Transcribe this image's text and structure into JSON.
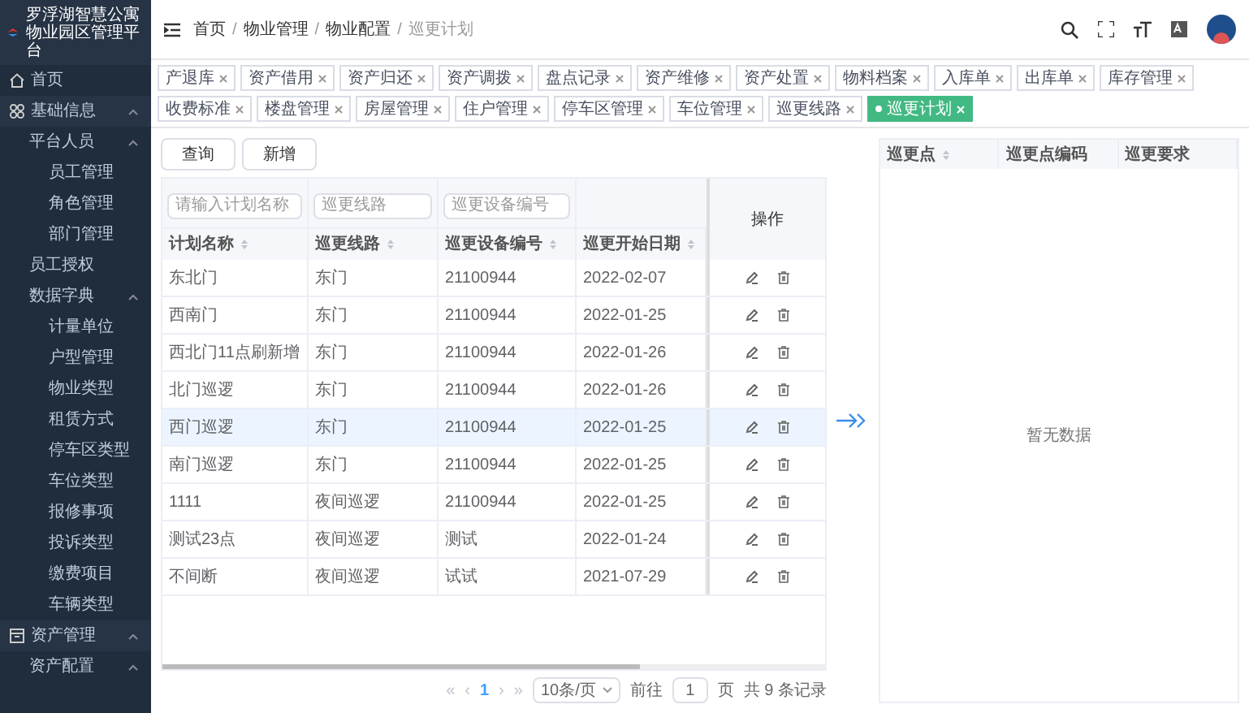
{
  "app_title": "罗浮湖智慧公寓物业园区管理平台",
  "sidebar": {
    "items": [
      {
        "label": "首页",
        "expanded": false
      },
      {
        "label": "基础信息",
        "expanded": true,
        "children": [
          {
            "label": "平台人员",
            "expanded": true,
            "children": [
              {
                "label": "员工管理"
              },
              {
                "label": "角色管理"
              },
              {
                "label": "部门管理"
              }
            ]
          },
          {
            "label": "员工授权"
          },
          {
            "label": "数据字典",
            "expanded": true,
            "children": [
              {
                "label": "计量单位"
              },
              {
                "label": "户型管理"
              },
              {
                "label": "物业类型"
              },
              {
                "label": "租赁方式"
              },
              {
                "label": "停车区类型"
              },
              {
                "label": "车位类型"
              },
              {
                "label": "报修事项"
              },
              {
                "label": "投诉类型"
              },
              {
                "label": "缴费项目"
              },
              {
                "label": "车辆类型"
              }
            ]
          }
        ]
      },
      {
        "label": "资产管理",
        "expanded": true,
        "children": [
          {
            "label": "资产配置",
            "expanded": true
          }
        ]
      }
    ]
  },
  "breadcrumb": [
    {
      "label": "首页"
    },
    {
      "separator": "/",
      "label": "物业管理"
    },
    {
      "separator": "/",
      "label": "物业配置"
    },
    {
      "separator": "/",
      "label": "巡更计划"
    }
  ],
  "tabs": [
    {
      "label": "产退库",
      "selected": false
    },
    {
      "label": "资产借用",
      "selected": false
    },
    {
      "label": "资产归还",
      "selected": false
    },
    {
      "label": "资产调拨",
      "selected": false
    },
    {
      "label": "盘点记录",
      "selected": false
    },
    {
      "label": "资产维修",
      "selected": false
    },
    {
      "label": "资产处置",
      "selected": false
    },
    {
      "label": "物料档案",
      "selected": false
    },
    {
      "label": "入库单",
      "selected": false
    },
    {
      "label": "出库单",
      "selected": false
    },
    {
      "label": "库存管理",
      "selected": false
    },
    {
      "label": "收费标准",
      "selected": false
    },
    {
      "label": "楼盘管理",
      "selected": false
    },
    {
      "label": "房屋管理",
      "selected": false
    },
    {
      "label": "住户管理",
      "selected": false
    },
    {
      "label": "停车区管理",
      "selected": false
    },
    {
      "label": "车位管理",
      "selected": false
    },
    {
      "label": "巡更线路",
      "selected": false
    },
    {
      "label": "巡更计划",
      "selected": true
    }
  ],
  "buttons": [
    "查询",
    "新增"
  ],
  "filters": [
    {
      "placeholder": "请输入计划名称"
    },
    {
      "placeholder": "巡更线路"
    },
    {
      "placeholder": "巡更设备编号"
    }
  ],
  "table": {
    "columns": [
      "计划名称",
      "巡更线路",
      "巡更设备编号",
      "巡更开始日期"
    ],
    "action_column": "操作",
    "rows": [
      {
        "cells": [
          "东北门",
          "东门",
          "21100944",
          "2022-02-07"
        ],
        "selected": false
      },
      {
        "cells": [
          "西南门",
          "东门",
          "21100944",
          "2022-01-25"
        ],
        "selected": false
      },
      {
        "cells": [
          "西北门11点刷新增",
          "东门",
          "21100944",
          "2022-01-26"
        ],
        "selected": false
      },
      {
        "cells": [
          "北门巡逻",
          "东门",
          "21100944",
          "2022-01-26"
        ],
        "selected": false
      },
      {
        "cells": [
          "西门巡逻",
          "东门",
          "21100944",
          "2022-01-25"
        ],
        "selected": true
      },
      {
        "cells": [
          "南门巡逻",
          "东门",
          "21100944",
          "2022-01-25"
        ],
        "selected": false
      },
      {
        "cells": [
          "1111",
          "夜间巡逻",
          "21100944",
          "2022-01-25"
        ],
        "selected": false
      },
      {
        "cells": [
          "测试23点",
          "夜间巡逻",
          "测试",
          "2022-01-24"
        ],
        "selected": false
      },
      {
        "cells": [
          "不间断",
          "夜间巡逻",
          "试试",
          "2021-07-29"
        ],
        "selected": false
      }
    ]
  },
  "pagination": {
    "first": "«",
    "prev": "‹",
    "pages": [
      {
        "label": "1",
        "selected": true
      }
    ],
    "next": "›",
    "last": "»",
    "page_size": "10条/页",
    "goto_label": "前往",
    "goto_value": "1",
    "page_unit": "页",
    "total": "共 9 条记录"
  },
  "points_table": {
    "columns": [
      "巡更点",
      "巡更点编码",
      "巡更要求"
    ],
    "empty_text": "暂无数据"
  }
}
